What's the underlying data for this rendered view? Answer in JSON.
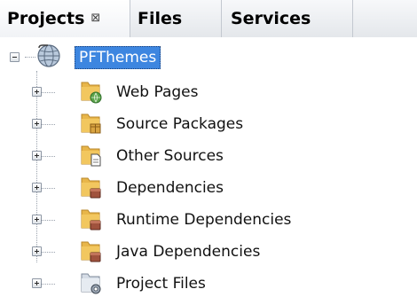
{
  "tabs": [
    {
      "label": "Projects",
      "close": "⊠",
      "active": true
    },
    {
      "label": "Files",
      "active": false
    },
    {
      "label": "Services",
      "active": false
    }
  ],
  "tree": {
    "root": {
      "label": "PFThemes",
      "icon": "globe-project-icon",
      "expanded": true
    },
    "children": [
      {
        "label": "Web Pages",
        "icon": "folder-web-icon"
      },
      {
        "label": "Source Packages",
        "icon": "folder-package-icon"
      },
      {
        "label": "Other Sources",
        "icon": "folder-file-icon"
      },
      {
        "label": "Dependencies",
        "icon": "folder-jar-icon"
      },
      {
        "label": "Runtime Dependencies",
        "icon": "folder-jar-icon"
      },
      {
        "label": "Java Dependencies",
        "icon": "folder-jar-icon"
      },
      {
        "label": "Project Files",
        "icon": "folder-config-icon"
      }
    ]
  },
  "colors": {
    "selection": "#3d86e0",
    "folder": "#e8b64a"
  }
}
